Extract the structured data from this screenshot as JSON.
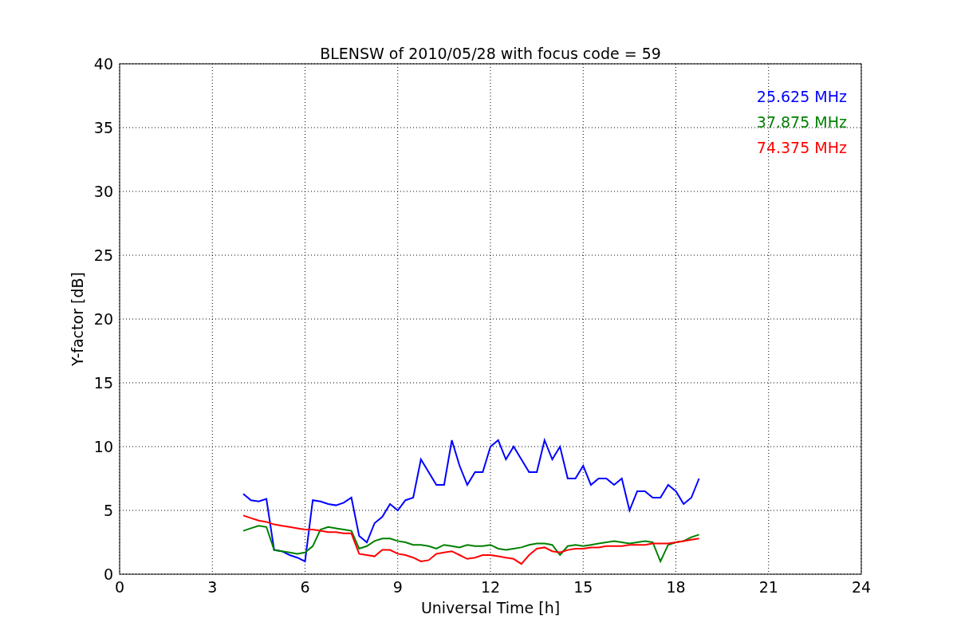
{
  "figure": {
    "chart_data": {
      "type": "line",
      "title": "BLENSW of 2010/05/28 with focus code = 59",
      "xlabel": "Universal Time [h]",
      "ylabel": "Y-factor [dB]",
      "x": [
        4.0,
        4.25,
        4.5,
        4.75,
        5.0,
        5.25,
        5.5,
        5.75,
        6.0,
        6.25,
        6.5,
        6.75,
        7.0,
        7.25,
        7.5,
        7.75,
        8.0,
        8.25,
        8.5,
        8.75,
        9.0,
        9.25,
        9.5,
        9.75,
        10.0,
        10.25,
        10.5,
        10.75,
        11.0,
        11.25,
        11.5,
        11.75,
        12.0,
        12.25,
        12.5,
        12.75,
        13.0,
        13.25,
        13.5,
        13.75,
        14.0,
        14.25,
        14.5,
        14.75,
        15.0,
        15.25,
        15.5,
        15.75,
        16.0,
        16.25,
        16.5,
        16.75,
        17.0,
        17.25,
        17.5,
        17.75,
        18.0,
        18.25,
        18.5,
        18.75
      ],
      "series": [
        {
          "name": "25.625 MHz",
          "color": "#0000ff",
          "values": [
            6.3,
            5.8,
            5.7,
            5.9,
            1.9,
            1.8,
            1.5,
            1.3,
            1.0,
            5.8,
            5.7,
            5.5,
            5.4,
            5.6,
            6.0,
            3.0,
            2.5,
            4.0,
            4.5,
            5.5,
            5.0,
            5.8,
            6.0,
            9.0,
            8.0,
            7.0,
            7.0,
            10.5,
            8.5,
            7.0,
            8.0,
            8.0,
            10.0,
            10.5,
            9.0,
            10.0,
            9.0,
            8.0,
            8.0,
            10.5,
            9.0,
            10.0,
            7.5,
            7.5,
            8.5,
            7.0,
            7.5,
            7.5,
            7.0,
            7.5,
            5.0,
            6.5,
            6.5,
            6.0,
            6.0,
            7.0,
            6.5,
            5.5,
            6.0,
            7.5
          ]
        },
        {
          "name": "37.875 MHz",
          "color": "#008000",
          "values": [
            3.4,
            3.6,
            3.8,
            3.7,
            1.9,
            1.8,
            1.7,
            1.6,
            1.7,
            2.2,
            3.5,
            3.7,
            3.6,
            3.5,
            3.4,
            2.0,
            2.2,
            2.6,
            2.8,
            2.8,
            2.6,
            2.5,
            2.3,
            2.3,
            2.2,
            2.0,
            2.3,
            2.2,
            2.1,
            2.3,
            2.2,
            2.2,
            2.3,
            2.0,
            1.9,
            2.0,
            2.1,
            2.3,
            2.4,
            2.4,
            2.3,
            1.5,
            2.2,
            2.3,
            2.2,
            2.3,
            2.4,
            2.5,
            2.6,
            2.5,
            2.4,
            2.5,
            2.6,
            2.5,
            1.0,
            2.3,
            2.5,
            2.6,
            2.9,
            3.1
          ]
        },
        {
          "name": "74.375 MHz",
          "color": "#ff0000",
          "values": [
            4.6,
            4.4,
            4.2,
            4.1,
            3.9,
            3.8,
            3.7,
            3.6,
            3.5,
            3.5,
            3.4,
            3.3,
            3.3,
            3.2,
            3.2,
            1.6,
            1.5,
            1.4,
            1.9,
            1.9,
            1.6,
            1.5,
            1.3,
            1.0,
            1.1,
            1.6,
            1.7,
            1.8,
            1.5,
            1.2,
            1.3,
            1.5,
            1.5,
            1.4,
            1.3,
            1.2,
            0.8,
            1.5,
            2.0,
            2.1,
            1.8,
            1.7,
            1.9,
            2.0,
            2.0,
            2.1,
            2.1,
            2.2,
            2.2,
            2.2,
            2.3,
            2.3,
            2.3,
            2.4,
            2.4,
            2.4,
            2.5,
            2.6,
            2.7,
            2.8
          ]
        }
      ],
      "grid": true,
      "xlim": [
        0,
        24
      ],
      "ylim": [
        0,
        40
      ],
      "xticks": [
        0,
        3,
        6,
        9,
        12,
        15,
        18,
        21,
        24
      ],
      "yticks": [
        0,
        5,
        10,
        15,
        20,
        25,
        30,
        35,
        40
      ]
    }
  }
}
